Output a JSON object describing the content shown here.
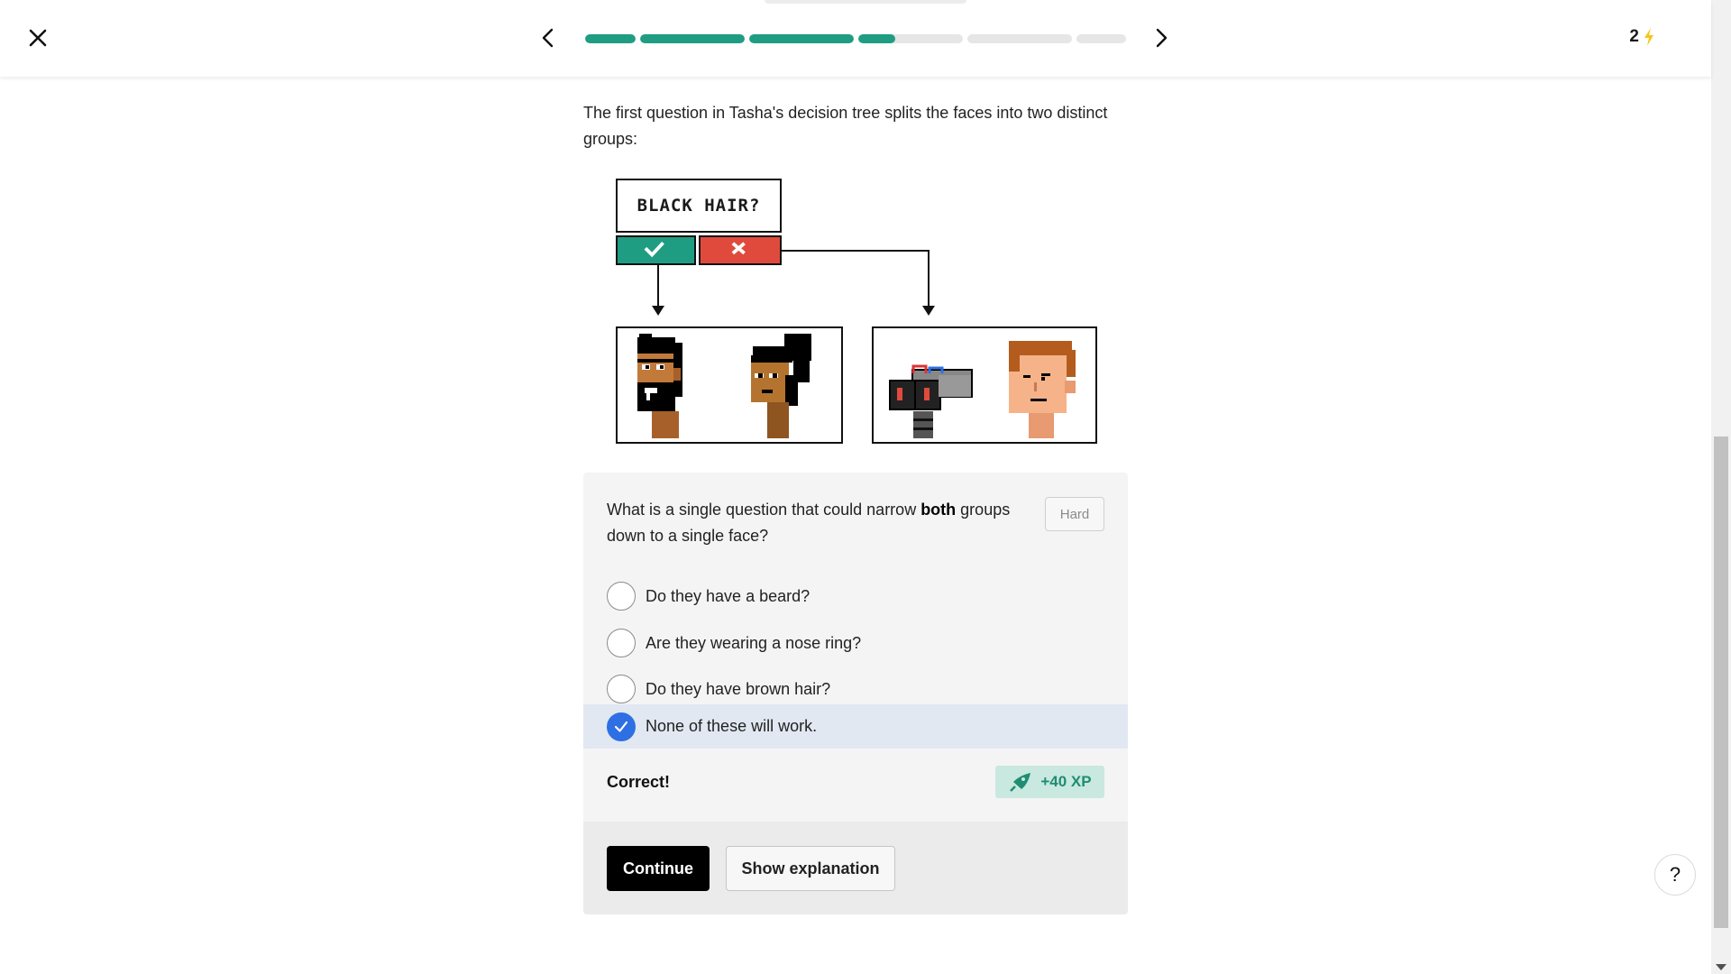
{
  "header": {
    "close_icon": "close-icon",
    "prev_icon": "chevron-left-icon",
    "next_icon": "chevron-right-icon",
    "progress_segments": [
      1,
      1,
      1,
      0.35,
      0,
      0
    ],
    "streak_count": "2",
    "streak_icon": "lightning-icon"
  },
  "intro": {
    "text": "The first question in Tasha's decision tree splits the faces into two distinct groups:"
  },
  "diagram": {
    "question_label": "BLACK HAIR?",
    "yes_icon": "check-icon",
    "no_icon": "x-icon",
    "left_group": [
      "bearded-man-face",
      "woman-with-bun-face"
    ],
    "right_group": [
      "robot-face",
      "brown-haired-man-face"
    ]
  },
  "card": {
    "question_pre": "What is a single question that could narrow ",
    "question_bold": "both",
    "question_post": " groups down to a single face?",
    "difficulty": "Hard",
    "options": [
      {
        "label": "Do they have a beard?",
        "selected": false
      },
      {
        "label": "Are they wearing a nose ring?",
        "selected": false
      },
      {
        "label": "Do they have brown hair?",
        "selected": false
      },
      {
        "label": "None of these will work.",
        "selected": true
      }
    ],
    "feedback": "Correct!",
    "xp": "+40 XP",
    "continue_label": "Continue",
    "explain_label": "Show explanation"
  },
  "help": {
    "label": "?"
  },
  "colors": {
    "accent_green": "#1f9d82",
    "wrong_red": "#e04a3c",
    "selected_blue": "#2f6fe4",
    "streak_yellow": "#f5c518"
  }
}
